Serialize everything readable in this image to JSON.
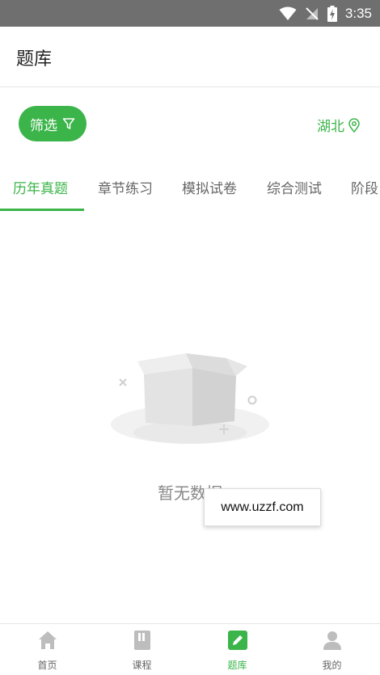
{
  "status_bar": {
    "time": "3:35"
  },
  "header": {
    "title": "题库"
  },
  "filter": {
    "label": "筛选"
  },
  "region": {
    "label": "湖北"
  },
  "tabs": [
    {
      "label": "历年真题",
      "active": true
    },
    {
      "label": "章节练习",
      "active": false
    },
    {
      "label": "模拟试卷",
      "active": false
    },
    {
      "label": "综合测试",
      "active": false
    },
    {
      "label": "阶段",
      "active": false
    }
  ],
  "empty_state": {
    "text": "暂无数据"
  },
  "watermark": {
    "text": "www.uzzf.com"
  },
  "bottom_nav": {
    "items": [
      {
        "label": "首页",
        "icon": "home-icon",
        "active": false
      },
      {
        "label": "课程",
        "icon": "book-icon",
        "active": false
      },
      {
        "label": "题库",
        "icon": "edit-icon",
        "active": true
      },
      {
        "label": "我的",
        "icon": "user-icon",
        "active": false
      }
    ]
  },
  "colors": {
    "accent": "#3bb54a",
    "status_bar": "#6f6f6f",
    "inactive": "#666666"
  }
}
